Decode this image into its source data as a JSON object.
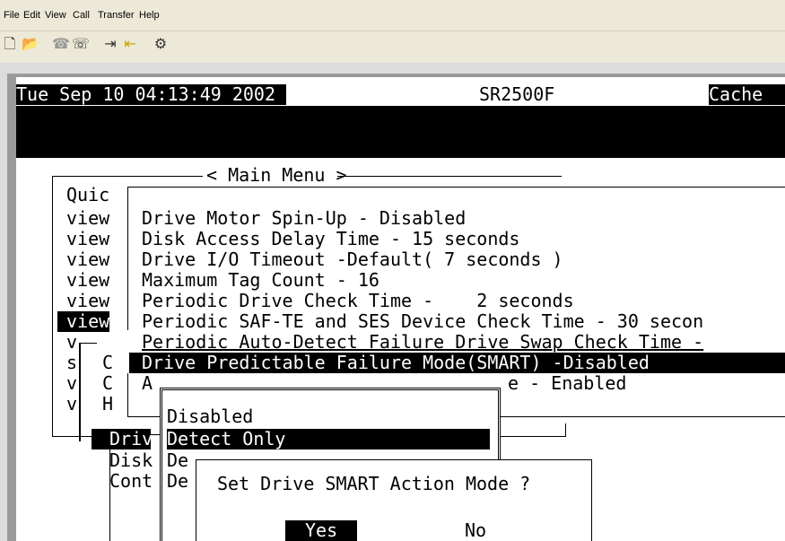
{
  "menubar": {
    "items": [
      "File",
      "Edit",
      "View",
      "Call",
      "Transfer",
      "Help"
    ]
  },
  "toolbar": {
    "icons": [
      "new-icon",
      "open-icon",
      "disconnect-icon",
      "phone-icon",
      "send-icon",
      "receive-icon",
      "properties-icon"
    ]
  },
  "status": {
    "datetime": "Tue Sep 10 04:13:49 2002",
    "model": "SR2500F",
    "cache": "Cache"
  },
  "main_menu": {
    "title": "< Main Menu >",
    "items": [
      "Quic",
      "view",
      "view",
      "view",
      "view",
      "view",
      "view",
      "v",
      "s",
      "v",
      "v"
    ]
  },
  "submenu_left": [
    "C",
    "C",
    "H"
  ],
  "config_menu": {
    "items": [
      "Drive Motor Spin-Up - Disabled",
      "Disk Access Delay Time - 15 seconds",
      "Drive I/O Timeout -Default( 7 seconds )",
      "Maximum Tag Count - 16",
      "Periodic Drive Check Time -    2 seconds",
      "Periodic SAF-TE and SES Device Check Time - 30 secon",
      "Periodic Auto-Detect Failure Drive Swap Check Time -",
      "Drive Predictable Failure Mode(SMART) -Disabled",
      "A"
    ],
    "partial_tail": "e - Enabled"
  },
  "drive_menu": {
    "items": [
      "Driv",
      "Disk",
      "Cont"
    ]
  },
  "smart_options": {
    "items": [
      "Disabled",
      "Detect Only",
      "De",
      "De"
    ]
  },
  "dialog": {
    "question": "Set Drive SMART Action Mode ?",
    "yes": "Yes",
    "no": "No"
  }
}
